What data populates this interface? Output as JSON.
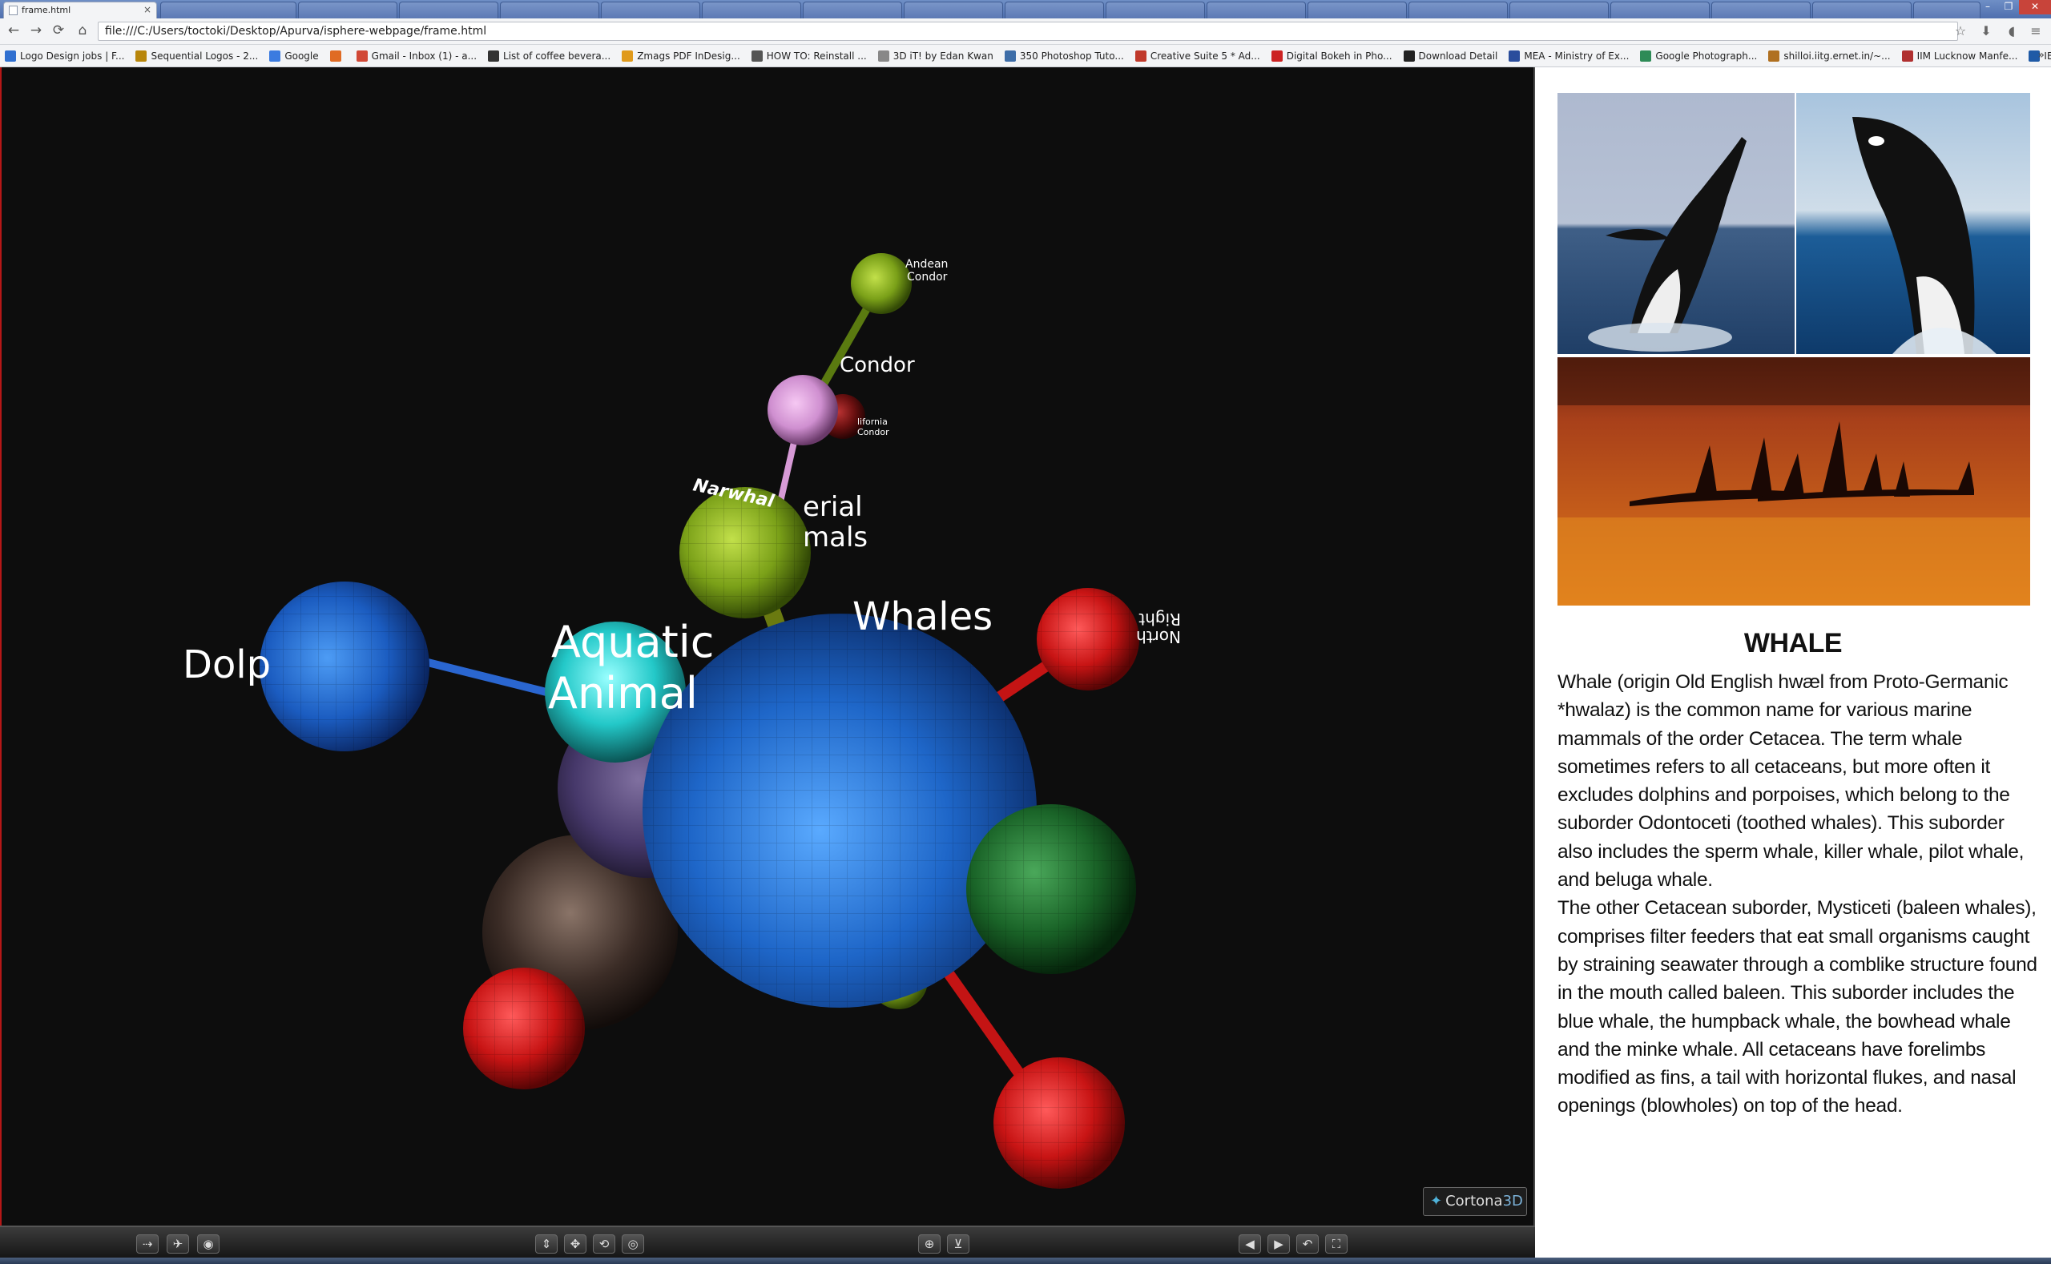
{
  "browser": {
    "active_tab": {
      "title": "frame.html",
      "close": "×"
    },
    "address_url": "file:///C:/Users/toctoki/Desktop/Apurva/isphere-webpage/frame.html",
    "nav": {
      "back": "←",
      "forward": "→",
      "reload": "⟳",
      "home": "⌂"
    },
    "bookmarks": [
      {
        "label": "Logo Design jobs | F...",
        "color": "#2f6fd0"
      },
      {
        "label": "Sequential Logos - 2...",
        "color": "#b8860b"
      },
      {
        "label": "Google",
        "color": "#3b7be0"
      },
      {
        "label": "",
        "color": "#e06b24"
      },
      {
        "label": "Gmail - Inbox (1) - a...",
        "color": "#d14836"
      },
      {
        "label": "List of coffee bevera...",
        "color": "#333333"
      },
      {
        "label": "Zmags PDF InDesig...",
        "color": "#e09a1c"
      },
      {
        "label": "HOW TO: Reinstall ...",
        "color": "#555555"
      },
      {
        "label": "3D iT! by Edan Kwan",
        "color": "#888888"
      },
      {
        "label": "350 Photoshop Tuto...",
        "color": "#3d6da8"
      },
      {
        "label": "Creative Suite 5 * Ad...",
        "color": "#c0392b"
      },
      {
        "label": "Digital Bokeh in Pho...",
        "color": "#cc2222"
      },
      {
        "label": "Download Detail",
        "color": "#222222"
      },
      {
        "label": "MEA - Ministry of Ex...",
        "color": "#2a4d9c"
      },
      {
        "label": "Google Photograph...",
        "color": "#2e8b57"
      },
      {
        "label": "shilloi.iitg.ernet.in/~...",
        "color": "#b07020"
      },
      {
        "label": "IIM Lucknow Manfe...",
        "color": "#b03030"
      },
      {
        "label": "IBM - The Great Min...",
        "color": "#1f5aa6"
      }
    ],
    "bookmarks_more": "»"
  },
  "scene": {
    "labels": {
      "andean_condor": [
        "Andean",
        "Condor"
      ],
      "condor": "Condor",
      "california_condor": [
        "lifornia",
        "Condor"
      ],
      "narwhal": "Narwhal",
      "aerial_animals": [
        "erial",
        "mals"
      ],
      "whales": "Whales",
      "dolphins": "Dolp",
      "aquatic_animals": [
        "Aquatic",
        "Animal"
      ],
      "north_right": [
        "North",
        "Right"
      ]
    },
    "colors": {
      "blue": "#1f6fd6",
      "red": "#d11a1a",
      "green_yellow": "#7fa31a",
      "cyan": "#2ed1d1",
      "pink": "#d99ad6",
      "dark_green": "#1b6b2a",
      "purple": "#4a3a66",
      "brown": "#3b2c26"
    }
  },
  "viewer_brand": {
    "prefix": "Cortona",
    "suffix": "3D"
  },
  "controls": {
    "left": [
      "walk-icon",
      "fly-icon",
      "eye-icon"
    ],
    "center": [
      "plan-icon",
      "pan-icon",
      "turn-icon",
      "roll-icon"
    ],
    "middle": [
      "goto-icon",
      "align-icon"
    ],
    "right": [
      "prev-view-icon",
      "next-view-icon",
      "restore-icon",
      "fit-icon"
    ]
  },
  "panel": {
    "title": "WHALE",
    "paragraphs": [
      "Whale (origin Old English hwæl from Proto-Germanic *hwalaz) is the common name for various marine mammals of the order Cetacea. The term whale sometimes refers to all cetaceans, but more often it excludes dolphins and porpoises, which belong to the suborder Odontoceti (toothed whales). This suborder also includes the sperm whale, killer whale, pilot whale, and beluga whale.",
      "The other Cetacean suborder, Mysticeti (baleen whales), comprises filter feeders that eat small organisms caught by straining seawater through a comblike structure found in the mouth called baleen. This suborder includes the blue whale, the humpback whale, the bowhead whale and the minke whale. All cetaceans have forelimbs modified as fins, a tail with horizontal flukes, and nasal openings (blowholes) on top of the head."
    ]
  }
}
